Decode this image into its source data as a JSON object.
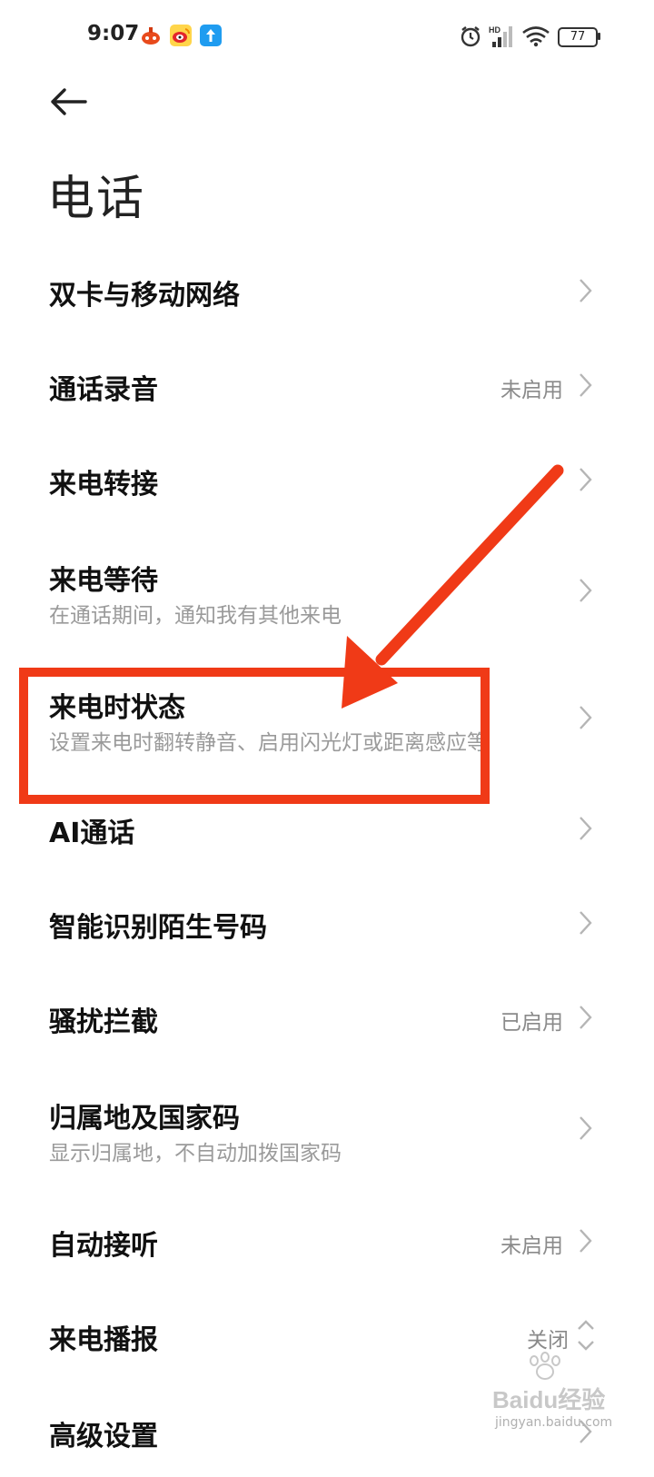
{
  "status_bar": {
    "time": "9:07",
    "battery": "77",
    "network_label": "HD"
  },
  "header": {
    "title": "电话"
  },
  "settings": [
    {
      "title": "双卡与移动网络",
      "subtitle": "",
      "value": ""
    },
    {
      "title": "通话录音",
      "subtitle": "",
      "value": "未启用"
    },
    {
      "title": "来电转接",
      "subtitle": "",
      "value": ""
    },
    {
      "title": "来电等待",
      "subtitle": "在通话期间，通知我有其他来电",
      "value": ""
    },
    {
      "title": "来电时状态",
      "subtitle": "设置来电时翻转静音、启用闪光灯或距离感应等",
      "value": ""
    },
    {
      "title": "AI通话",
      "subtitle": "",
      "value": ""
    },
    {
      "title": "智能识别陌生号码",
      "subtitle": "",
      "value": ""
    },
    {
      "title": "骚扰拦截",
      "subtitle": "",
      "value": "已启用"
    },
    {
      "title": "归属地及国家码",
      "subtitle": "显示归属地，不自动加拨国家码",
      "value": ""
    },
    {
      "title": "自动接听",
      "subtitle": "",
      "value": "未启用"
    },
    {
      "title": "来电播报",
      "subtitle": "",
      "value": "关闭"
    },
    {
      "title": "高级设置",
      "subtitle": "",
      "value": ""
    }
  ],
  "annotation": {
    "color": "#f03a17"
  },
  "watermark": {
    "logo_text": "Baidu经验",
    "url_text": "jingyan.baidu.com"
  }
}
